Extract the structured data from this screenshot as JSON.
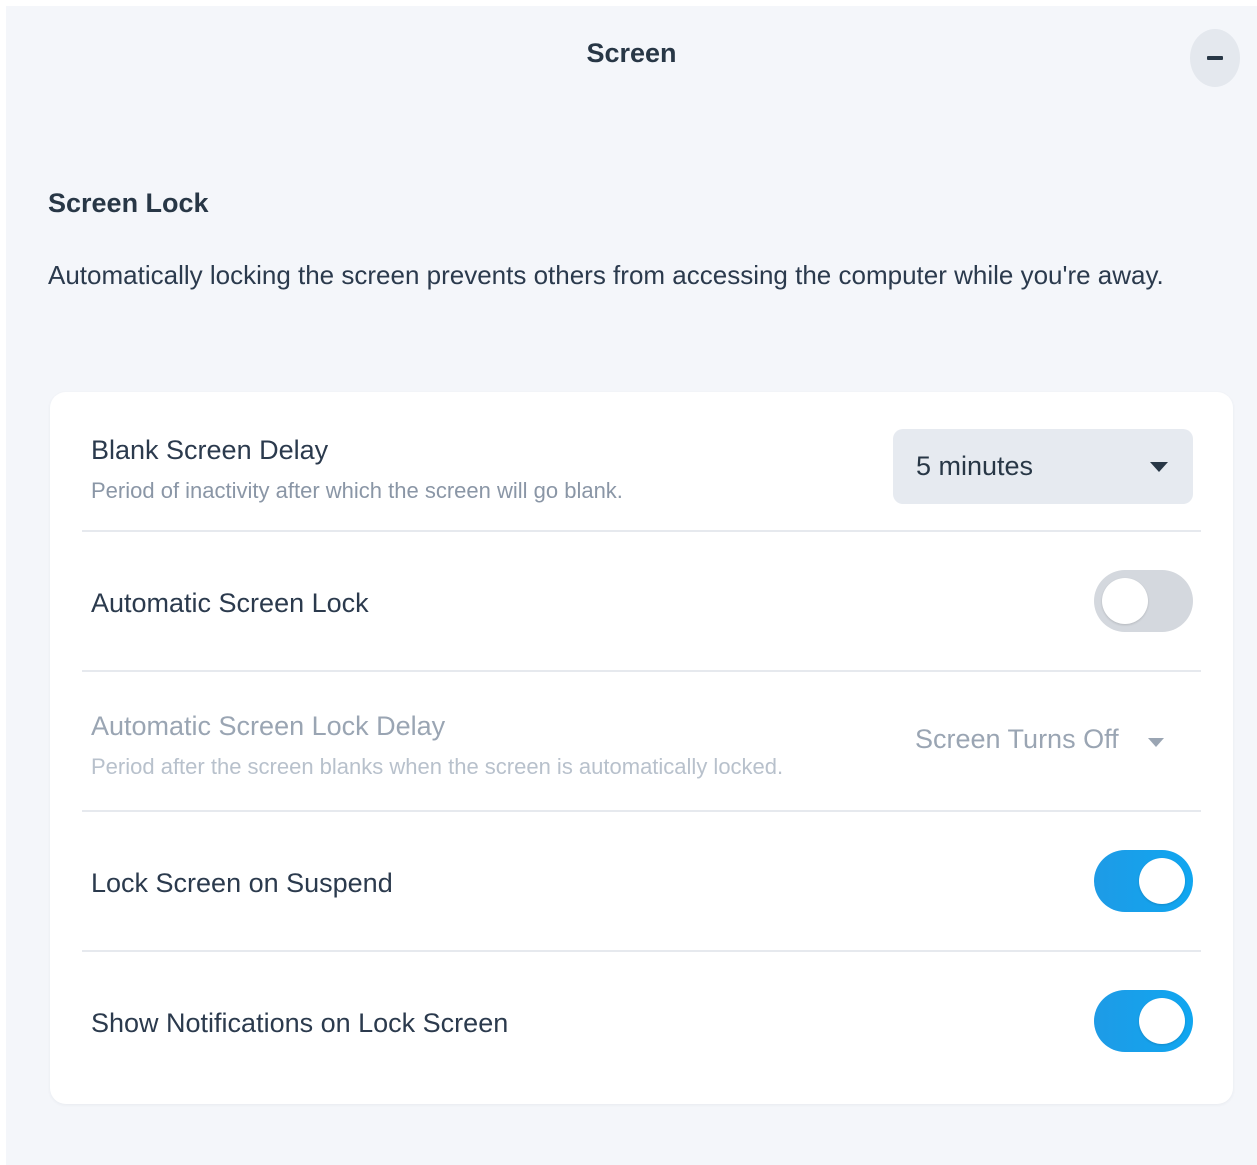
{
  "header": {
    "title": "Screen",
    "minimize_icon": "minus-icon"
  },
  "section": {
    "title": "Screen Lock",
    "description": "Automatically locking the screen prevents others from accessing the computer while you're away."
  },
  "settings": {
    "blank_delay": {
      "label": "Blank Screen Delay",
      "subtitle": "Period of inactivity after which the screen will go blank.",
      "value": "5 minutes"
    },
    "auto_lock": {
      "label": "Automatic Screen Lock",
      "enabled": false
    },
    "auto_lock_delay": {
      "label": "Automatic Screen Lock Delay",
      "subtitle": "Period after the screen blanks when the screen is automatically locked.",
      "value": "Screen Turns Off",
      "disabled": true
    },
    "lock_on_suspend": {
      "label": "Lock Screen on Suspend",
      "enabled": true
    },
    "show_notifications": {
      "label": "Show Notifications on Lock Screen",
      "enabled": true
    }
  },
  "colors": {
    "accent": "#1e9be6",
    "background": "#f4f6fa",
    "card": "#ffffff",
    "text": "#2b3a4d",
    "muted": "#8a96a6"
  }
}
